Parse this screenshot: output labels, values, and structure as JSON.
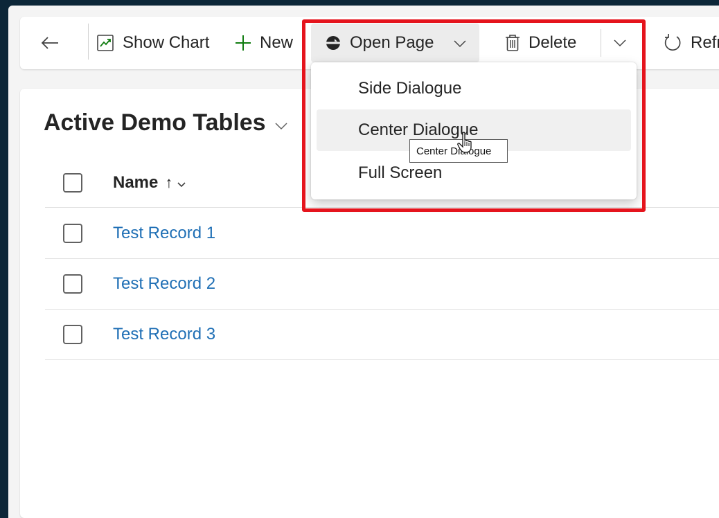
{
  "commandbar": {
    "show_chart_label": "Show Chart",
    "new_label": "New",
    "open_page_label": "Open Page",
    "delete_label": "Delete",
    "refresh_label": "Refre"
  },
  "icons": {
    "back": "arrow-left-icon",
    "show_chart": "chart-icon",
    "new": "plus-icon",
    "open_page": "open-page-icon",
    "delete": "trash-icon",
    "more": "chevron-down-icon",
    "refresh": "refresh-icon"
  },
  "dropdown": {
    "items": [
      {
        "label": "Side Dialogue"
      },
      {
        "label": "Center Dialogue"
      },
      {
        "label": "Full Screen"
      }
    ],
    "hovered_item": "Center Dialogue",
    "tooltip": "Center Dialogue"
  },
  "view": {
    "title": "Active Demo Tables",
    "column_name": "Name",
    "sort_indicator": "↑",
    "rows": [
      {
        "name": "Test Record 1"
      },
      {
        "name": "Test Record 2"
      },
      {
        "name": "Test Record 3"
      }
    ]
  },
  "colors": {
    "accent_link": "#1f6fb5",
    "highlight_border": "#e5141d",
    "new_icon": "#107c10",
    "background": "#0c2638"
  }
}
